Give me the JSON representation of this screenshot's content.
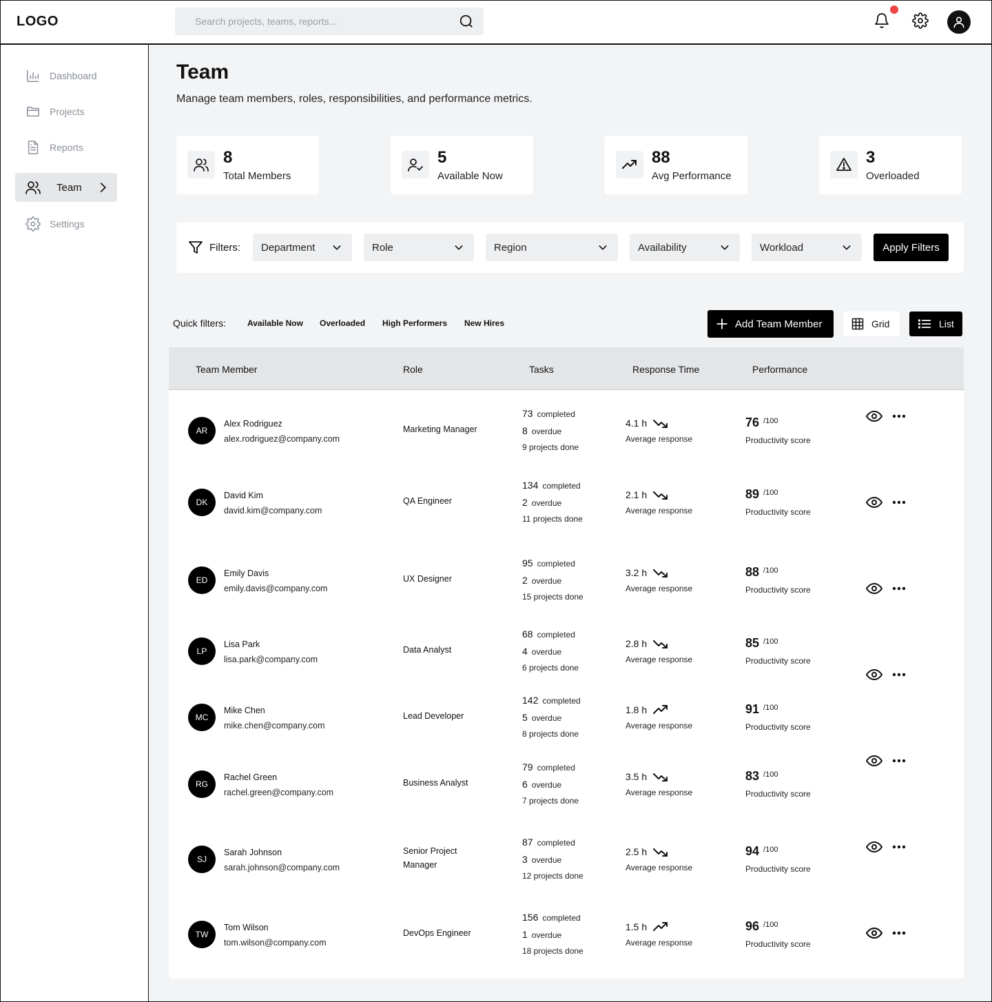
{
  "header": {
    "logo": "LOGO",
    "search_placeholder": "Search projects, teams, reports..."
  },
  "sidebar": {
    "items": [
      {
        "label": "Dashboard",
        "icon": "chart-icon"
      },
      {
        "label": "Projects",
        "icon": "folder-icon"
      },
      {
        "label": "Reports",
        "icon": "document-icon"
      },
      {
        "label": "Team",
        "icon": "users-icon",
        "active": true
      },
      {
        "label": "Settings",
        "icon": "gear-icon"
      }
    ]
  },
  "page": {
    "title": "Team",
    "subtitle": "Manage team members, roles, responsibilities, and performance metrics."
  },
  "stats": [
    {
      "value": "8",
      "label": "Total Members",
      "icon": "users-icon"
    },
    {
      "value": "5",
      "label": "Available Now",
      "icon": "user-check-icon"
    },
    {
      "value": "88",
      "label": "Avg Performance",
      "icon": "trending-up-icon"
    },
    {
      "value": "3",
      "label": "Overloaded",
      "icon": "warning-icon"
    }
  ],
  "filters": {
    "label": "Filters:",
    "dropdowns": [
      "Department",
      "Role",
      "Region",
      "Availability",
      "Workload"
    ],
    "apply_label": "Apply Filters"
  },
  "quick_filters": {
    "label": "Quick filters:",
    "items": [
      "Available Now",
      "Overloaded",
      "High Performers",
      "New Hires"
    ]
  },
  "actions": {
    "add_label": "Add Team Member",
    "grid_label": "Grid",
    "list_label": "List"
  },
  "table": {
    "columns": [
      "Team Member",
      "Role",
      "Tasks",
      "Response Time",
      "Performance"
    ],
    "labels": {
      "completed": "completed",
      "overdue": "overdue",
      "avg_response": "Average response",
      "out_of": "/100",
      "productivity": "Productivity score"
    },
    "rows": [
      {
        "initials": "AR",
        "name": "Alex Rodriguez",
        "email": "alex.rodriguez@company.com",
        "role": "Marketing Manager",
        "completed": "73",
        "overdue": "8",
        "projects": "9 projects done",
        "response": "4.1 h",
        "trend": "down",
        "score": "76"
      },
      {
        "initials": "DK",
        "name": "David Kim",
        "email": "david.kim@company.com",
        "role": "QA Engineer",
        "completed": "134",
        "overdue": "2",
        "projects": "11 projects done",
        "response": "2.1 h",
        "trend": "down",
        "score": "89"
      },
      {
        "initials": "ED",
        "name": "Emily Davis",
        "email": "emily.davis@company.com",
        "role": "UX Designer",
        "completed": "95",
        "overdue": "2",
        "projects": "15 projects done",
        "response": "3.2 h",
        "trend": "down",
        "score": "88"
      },
      {
        "initials": "LP",
        "name": "Lisa Park",
        "email": "lisa.park@company.com",
        "role": "Data Analyst",
        "completed": "68",
        "overdue": "4",
        "projects": "6 projects done",
        "response": "2.8 h",
        "trend": "down",
        "score": "85"
      },
      {
        "initials": "MC",
        "name": "Mike Chen",
        "email": "mike.chen@company.com",
        "role": "Lead Developer",
        "completed": "142",
        "overdue": "5",
        "projects": "8 projects done",
        "response": "1.8 h",
        "trend": "up",
        "score": "91"
      },
      {
        "initials": "RG",
        "name": "Rachel Green",
        "email": "rachel.green@company.com",
        "role": "Business Analyst",
        "completed": "79",
        "overdue": "6",
        "projects": "7 projects done",
        "response": "3.5 h",
        "trend": "down",
        "score": "83"
      },
      {
        "initials": "SJ",
        "name": "Sarah Johnson",
        "email": "sarah.johnson@company.com",
        "role": "Senior Project Manager",
        "completed": "87",
        "overdue": "3",
        "projects": "12 projects done",
        "response": "2.5 h",
        "trend": "down",
        "score": "94"
      },
      {
        "initials": "TW",
        "name": "Tom Wilson",
        "email": "tom.wilson@company.com",
        "role": "DevOps Engineer",
        "completed": "156",
        "overdue": "1",
        "projects": "18 projects done",
        "response": "1.5 h",
        "trend": "up",
        "score": "96"
      }
    ]
  },
  "colors": {
    "accent": "#000000",
    "notification": "#ef4444",
    "page_bg": "#f3f4f6"
  }
}
